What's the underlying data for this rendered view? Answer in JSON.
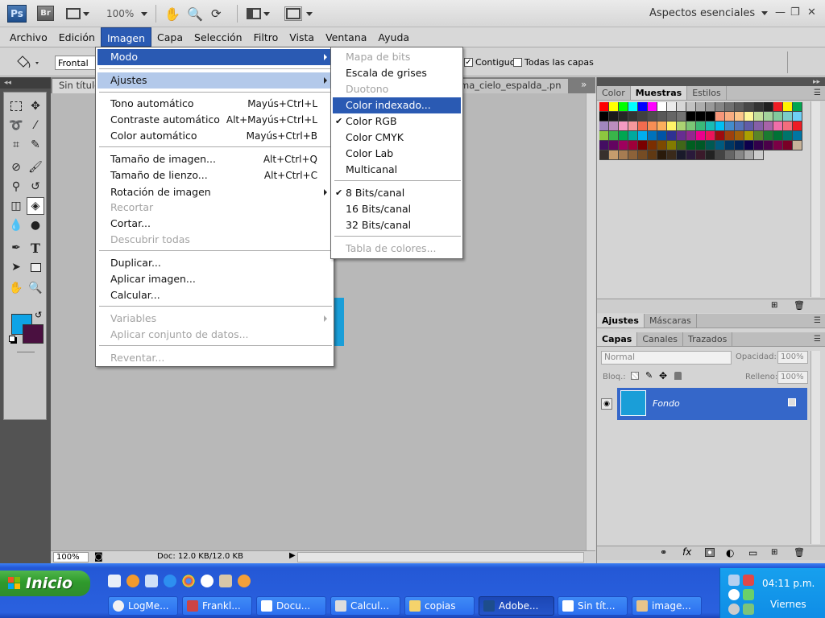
{
  "appbar": {
    "ps_logo": "Ps",
    "br_logo": "Br",
    "zoom": "100%",
    "workspace": "Aspectos esenciales",
    "icons": [
      "hand-icon",
      "zoom-icon",
      "rotate-view-icon",
      "arrange-documents-icon",
      "screen-mode-icon"
    ]
  },
  "menubar": [
    "Archivo",
    "Edición",
    "Imagen",
    "Capa",
    "Selección",
    "Filtro",
    "Vista",
    "Ventana",
    "Ayuda"
  ],
  "options": {
    "fill_source": "Frontal",
    "contiguo_label": "Contiguo",
    "contiguo_checked": true,
    "todas_capas_label": "Todas las capas",
    "todas_capas_checked": false
  },
  "doc": {
    "tab_active": "Sin título",
    "tab_other": "ma_cielo_espalda_.pn",
    "zoom": "100%",
    "status": "Doc: 12.0 KB/12.0 KB"
  },
  "imagen_menu": {
    "items": [
      {
        "label": "Modo",
        "submenu": true,
        "state": "highlighted"
      },
      {
        "label": "Ajustes",
        "submenu": true,
        "state": "hover"
      },
      {
        "label": "Tono automático",
        "shortcut": "Mayús+Ctrl+L"
      },
      {
        "label": "Contraste automático",
        "shortcut": "Alt+Mayús+Ctrl+L"
      },
      {
        "label": "Color automático",
        "shortcut": "Mayús+Ctrl+B"
      },
      {
        "label": "Tamaño de imagen...",
        "shortcut": "Alt+Ctrl+Q"
      },
      {
        "label": "Tamaño de lienzo...",
        "shortcut": "Alt+Ctrl+C"
      },
      {
        "label": "Rotación de imagen",
        "submenu": true
      },
      {
        "label": "Recortar",
        "disabled": true
      },
      {
        "label": "Cortar..."
      },
      {
        "label": "Descubrir todas",
        "disabled": true
      },
      {
        "label": "Duplicar..."
      },
      {
        "label": "Aplicar imagen..."
      },
      {
        "label": "Calcular..."
      },
      {
        "label": "Variables",
        "submenu": true,
        "disabled": true
      },
      {
        "label": "Aplicar conjunto de datos...",
        "disabled": true
      },
      {
        "label": "Reventar...",
        "disabled": true
      }
    ]
  },
  "modo_menu": {
    "items": [
      {
        "label": "Mapa de bits",
        "disabled": true
      },
      {
        "label": "Escala de grises"
      },
      {
        "label": "Duotono",
        "disabled": true
      },
      {
        "label": "Color indexado...",
        "state": "highlighted"
      },
      {
        "label": "Color RGB",
        "checked": true
      },
      {
        "label": "Color CMYK"
      },
      {
        "label": "Color Lab"
      },
      {
        "label": "Multicanal"
      },
      {
        "label": "8 Bits/canal",
        "checked": true
      },
      {
        "label": "16 Bits/canal"
      },
      {
        "label": "32 Bits/canal"
      },
      {
        "label": "Tabla de colores...",
        "disabled": true
      }
    ]
  },
  "swatch_panel": {
    "tabs": [
      "Color",
      "Muestras",
      "Estilos"
    ],
    "active_tab": "Muestras"
  },
  "adjust_panel": {
    "tabs": [
      "Ajustes",
      "Máscaras"
    ]
  },
  "layers_panel": {
    "tabs": [
      "Capas",
      "Canales",
      "Trazados"
    ],
    "blend_mode": "Normal",
    "opacity_label": "Opacidad:",
    "opacity": "100%",
    "lock_label": "Bloq.:",
    "fill_label": "Relleno:",
    "fill": "100%",
    "layer_name": "Fondo"
  },
  "colors": {
    "foreground": "#0ea3e6",
    "background": "#4a1040",
    "menu_highlight": "#2a5ab3",
    "layer_selected": "#3567c9"
  },
  "taskbar": {
    "start_label": "Inicio",
    "tasks": [
      "LogMe...",
      "Frankl...",
      "Docu...",
      "Calcul...",
      "copias",
      "Adobe...",
      "Sin tít...",
      "image..."
    ],
    "time": "04:11 p.m.",
    "day": "Viernes"
  }
}
